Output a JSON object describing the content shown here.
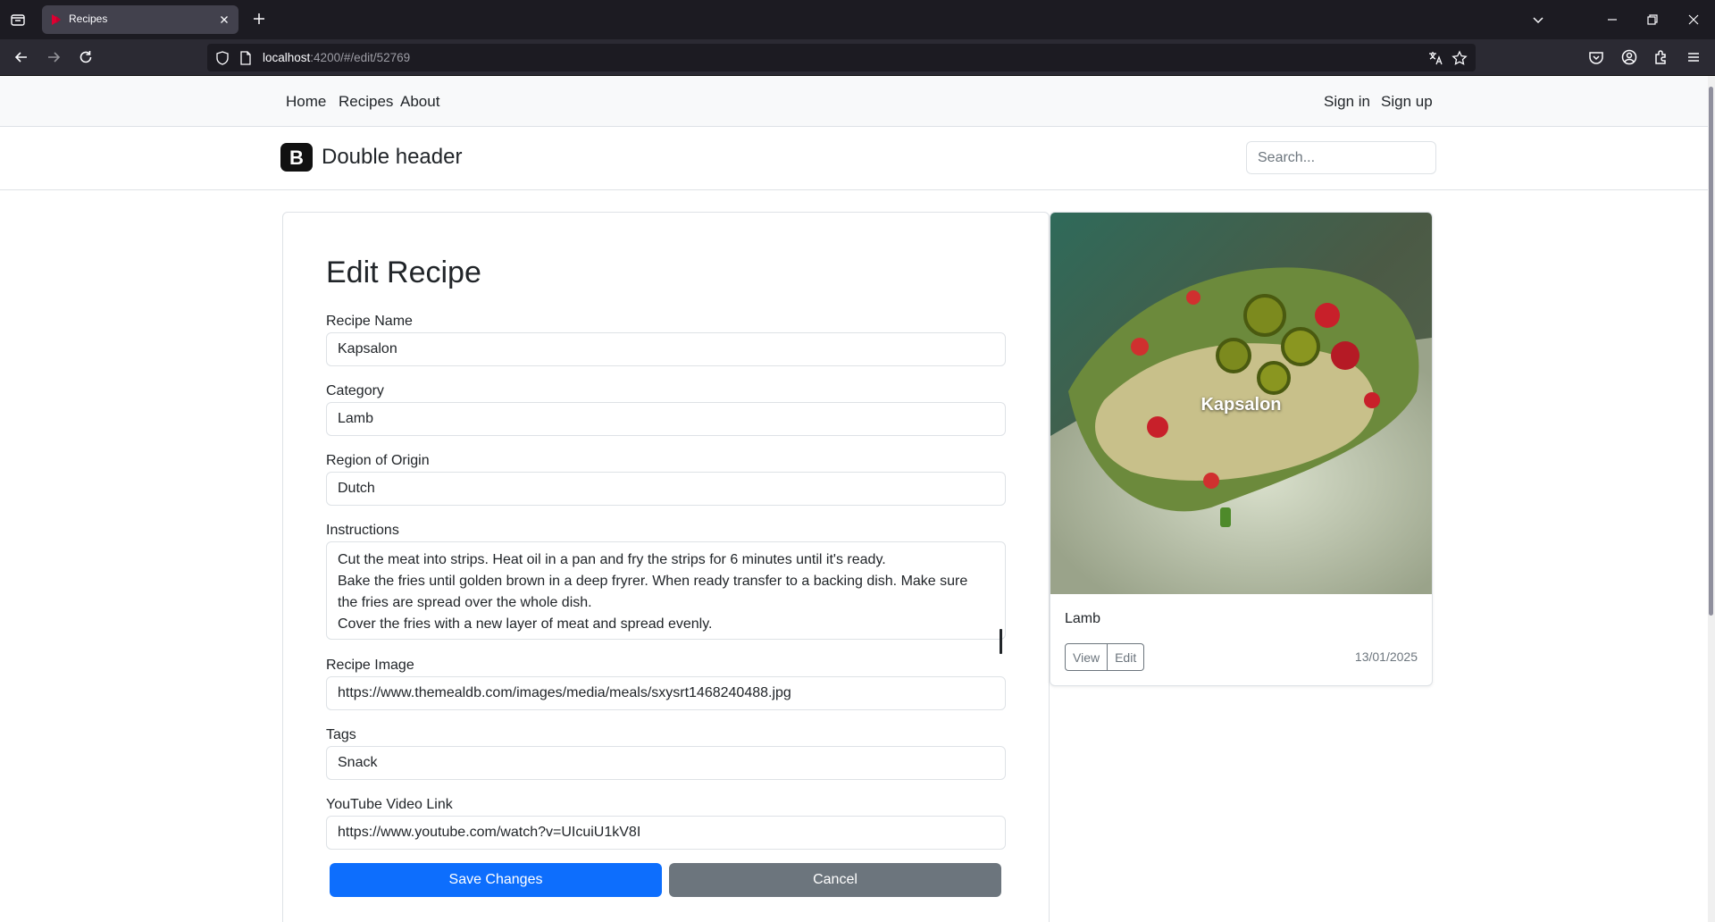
{
  "browser": {
    "tab_title": "Recipes",
    "url_host": "localhost",
    "url_rest": ":4200/#/edit/52769"
  },
  "topnav": {
    "links": [
      "Home",
      "Recipes",
      "About"
    ],
    "sign_in": "Sign in",
    "sign_up": "Sign up"
  },
  "header": {
    "logo_letter": "B",
    "brand": "Double header",
    "search_placeholder": "Search..."
  },
  "form": {
    "title": "Edit Recipe",
    "fields": {
      "name": {
        "label": "Recipe Name",
        "value": "Kapsalon"
      },
      "category": {
        "label": "Category",
        "value": "Lamb"
      },
      "region": {
        "label": "Region of Origin",
        "value": "Dutch"
      },
      "instructions": {
        "label": "Instructions",
        "value": "Cut the meat into strips. Heat oil in a pan and fry the strips for 6 minutes until it's ready.\nBake the fries until golden brown in a deep fryrer. When ready transfer to a backing dish. Make sure the fries are spread over the whole dish.\nCover the fries with a new layer of meat and spread evenly."
      },
      "image": {
        "label": "Recipe Image",
        "value": "https://www.themealdb.com/images/media/meals/sxysrt1468240488.jpg"
      },
      "tags": {
        "label": "Tags",
        "value": "Snack"
      },
      "youtube": {
        "label": "YouTube Video Link",
        "value": "https://www.youtube.com/watch?v=UIcuiU1kV8I"
      }
    },
    "save_label": "Save Changes",
    "cancel_label": "Cancel"
  },
  "card": {
    "overlay_title": "Kapsalon",
    "category": "Lamb",
    "view_label": "View",
    "edit_label": "Edit",
    "date": "13/01/2025"
  },
  "colors": {
    "primary": "#0d6efd",
    "secondary": "#6c757d",
    "browser_dark": "#1c1b22"
  }
}
